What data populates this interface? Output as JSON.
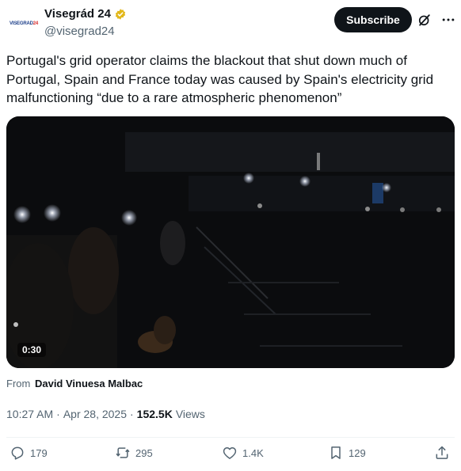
{
  "author": {
    "display_name": "Visegrád 24",
    "handle": "@visegrad24",
    "avatar_text_main": "VISEGRAD",
    "avatar_text_accent": "24",
    "verified_badge_color": "#e2b719"
  },
  "header": {
    "subscribe_label": "Subscribe",
    "grok_icon": "grok-icon",
    "more_icon": "more-icon"
  },
  "tweet": {
    "text": "Portugal's grid operator claims the blackout that shut down much of Portugal, Spain and France today was caused by Spain's electricity grid malfunctioning “due to a rare atmospheric phenomenon”"
  },
  "media": {
    "duration": "0:30"
  },
  "source": {
    "prefix": "From",
    "author": "David Vinuesa Malbac"
  },
  "meta": {
    "time": "10:27 AM",
    "separator1": "·",
    "date": "Apr 28, 2025",
    "separator2": "·",
    "views_count": "152.5K",
    "views_label": "Views"
  },
  "actions": {
    "replies": "179",
    "reposts": "295",
    "likes": "1.4K",
    "bookmarks": "129"
  },
  "colors": {
    "text_primary": "#0f1419",
    "text_secondary": "#536471",
    "button_bg": "#0f1419"
  }
}
